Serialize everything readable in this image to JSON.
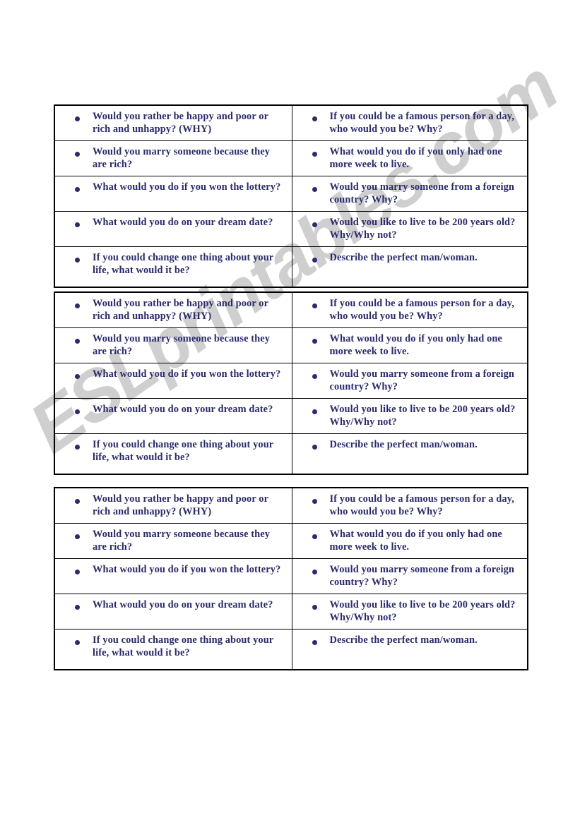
{
  "document": {
    "kind": "worksheet",
    "page_background": "#ffffff",
    "text_color": "#2b2b6e",
    "border_color": "#000000"
  },
  "watermark": {
    "text": "ESLprintables.com",
    "color": "#cfcfcf",
    "rotation_deg": -35
  },
  "questions": {
    "left": [
      "Would you rather be happy and poor or rich and unhappy? (WHY)",
      "Would you marry someone because they are rich?",
      "What would you do if you won the lottery?",
      "What would you do on your dream date?",
      "If you could change one thing about your life, what would it be?"
    ],
    "right": [
      "If you could be a famous person for a day, who would you be? Why?",
      "What would you do if you only had one more week to live.",
      "Would you marry someone from a foreign country? Why?",
      "Would you like to live to be 200 years old? Why/Why not?",
      "Describe the perfect man/woman."
    ]
  },
  "tables": [
    {
      "id": "table-1",
      "copy_number": 1
    },
    {
      "id": "table-2",
      "copy_number": 2
    },
    {
      "id": "table-3",
      "copy_number": 3
    }
  ]
}
